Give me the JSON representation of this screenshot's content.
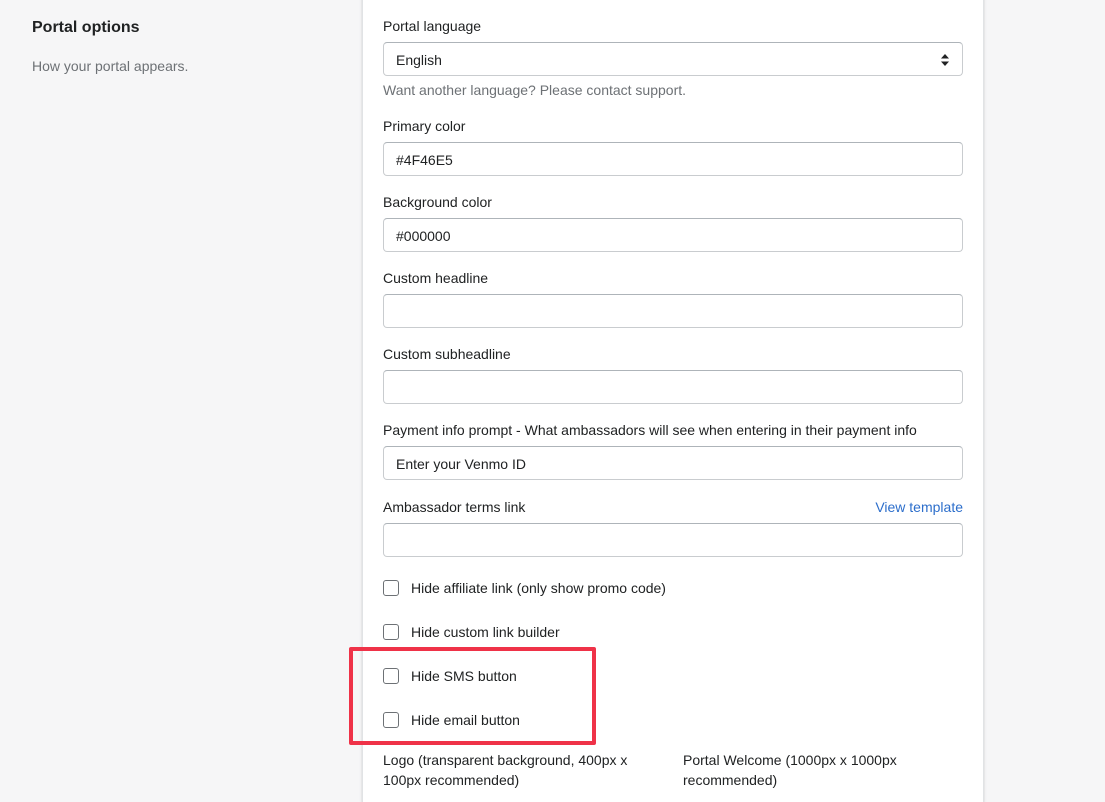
{
  "aside": {
    "title": "Portal options",
    "description": "How your portal appears."
  },
  "fields": {
    "language": {
      "label": "Portal language",
      "value": "English",
      "help": "Want another language? Please contact support."
    },
    "primary_color": {
      "label": "Primary color",
      "value": "#4F46E5"
    },
    "background_color": {
      "label": "Background color",
      "value": "#000000"
    },
    "custom_headline": {
      "label": "Custom headline",
      "value": ""
    },
    "custom_subheadline": {
      "label": "Custom subheadline",
      "value": ""
    },
    "payment_prompt": {
      "label": "Payment info prompt - What ambassadors will see when entering in their payment info",
      "value": "Enter your Venmo ID"
    },
    "terms_link": {
      "label": "Ambassador terms link",
      "link_text": "View template",
      "value": ""
    }
  },
  "checkboxes": {
    "hide_affiliate": "Hide affiliate link (only show promo code)",
    "hide_custom_link": "Hide custom link builder",
    "hide_sms": "Hide SMS button",
    "hide_email": "Hide email button"
  },
  "uploads": {
    "logo": "Logo (transparent background, 400px x 100px recommended)",
    "welcome": "Portal Welcome (1000px x 1000px recommended)"
  },
  "colors": {
    "highlight": "#ef3248",
    "link": "#2c6ecb"
  }
}
